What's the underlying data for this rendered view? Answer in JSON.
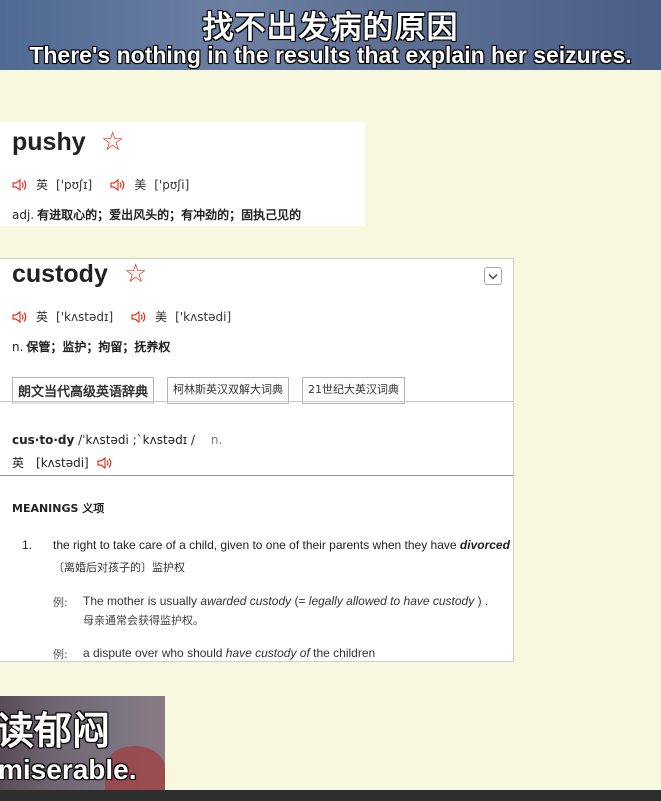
{
  "video_top": {
    "subtitle_cn": "找不出发病的原因",
    "subtitle_en": "There's nothing in the results that explain her seizures."
  },
  "pushy": {
    "headword": "pushy",
    "uk_label": "英",
    "uk_ipa": "['pʊʃɪ]",
    "us_label": "美",
    "us_ipa": "['pʊʃi]",
    "pos": "adj.",
    "definition": "有进取心的；爱出风头的；有冲劲的；固执己见的"
  },
  "custody": {
    "headword": "custody",
    "uk_label": "英",
    "uk_ipa": "['kʌstədɪ]",
    "us_label": "美",
    "us_ipa": "['kʌstədi]",
    "pos": "n.",
    "definition": "保管；监护；拘留；抚养权",
    "tabs": [
      {
        "label": "朗文当代高级英语辞典",
        "active": true
      },
      {
        "label": "柯林斯英汉双解大词典",
        "active": false
      },
      {
        "label": "21世纪大英汉词典",
        "active": false
      }
    ],
    "syllables": "cus·to·dy",
    "entry_ipa": "/ˈkʌstədi ;ˋkʌstədɪ /",
    "entry_pos": "n.",
    "entry_uk_label": "英",
    "entry_uk_ipa": "[kʌstədi]",
    "meanings_heading": "MEANINGS 义项",
    "sense_number": "1.",
    "sense_def_start": "the right to take care of a child, given to one of their parents when they have ",
    "sense_def_em": "divorced",
    "sense_cn": "〔离婚后对孩子的〕监护权",
    "examples": [
      {
        "label": "例:",
        "t1": "The mother is usually ",
        "t2": "awarded custody",
        "t3": " (= ",
        "t4": "legally allowed to have custody",
        "t5": " ) .",
        "cn": "母亲通常会获得监护权。"
      },
      {
        "label": "例:",
        "t1": "a dispute over who should ",
        "t2": "have custody of",
        "t3": " the children"
      }
    ]
  },
  "video_bottom": {
    "subtitle_cn": "读郁闷",
    "subtitle_en": "miserable."
  },
  "icons": {
    "star": "star-outline-icon",
    "speaker": "speaker-icon",
    "chevron": "chevron-down-icon"
  },
  "colors": {
    "accent_red": "#e8321e",
    "page_background": "#f7f8dd"
  }
}
